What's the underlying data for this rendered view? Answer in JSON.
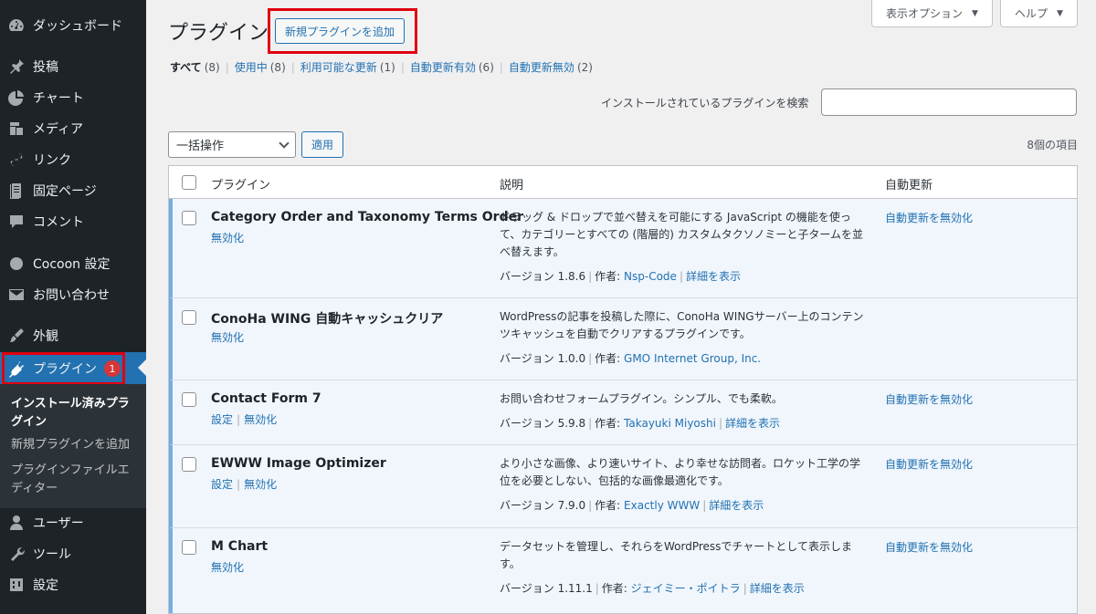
{
  "sidebar": {
    "items": [
      {
        "label": "ダッシュボード",
        "icon": "dashboard-icon"
      },
      {
        "label": "投稿",
        "icon": "pin-icon"
      },
      {
        "label": "チャート",
        "icon": "pie-chart-icon"
      },
      {
        "label": "メディア",
        "icon": "media-icon"
      },
      {
        "label": "リンク",
        "icon": "link-icon"
      },
      {
        "label": "固定ページ",
        "icon": "page-icon"
      },
      {
        "label": "コメント",
        "icon": "comment-icon"
      },
      {
        "label": "Cocoon 設定",
        "icon": "circle-icon"
      },
      {
        "label": "お問い合わせ",
        "icon": "mail-icon"
      },
      {
        "label": "外観",
        "icon": "brush-icon"
      },
      {
        "label": "プラグイン",
        "icon": "plugin-icon",
        "badge": "1"
      },
      {
        "label": "ユーザー",
        "icon": "user-icon"
      },
      {
        "label": "ツール",
        "icon": "wrench-icon"
      },
      {
        "label": "設定",
        "icon": "settings-icon"
      }
    ],
    "submenu": [
      {
        "label": "インストール済みプラグイン"
      },
      {
        "label": "新規プラグインを追加"
      },
      {
        "label": "プラグインファイルエディター"
      }
    ]
  },
  "header": {
    "title": "プラグイン",
    "add_new": "新規プラグインを追加",
    "screen_options": "表示オプション",
    "help": "ヘルプ"
  },
  "filters": [
    {
      "label": "すべて",
      "count": "(8)"
    },
    {
      "label": "使用中",
      "count": "(8)"
    },
    {
      "label": "利用可能な更新",
      "count": "(1)"
    },
    {
      "label": "自動更新有効",
      "count": "(6)"
    },
    {
      "label": "自動更新無効",
      "count": "(2)"
    }
  ],
  "search": {
    "label": "インストールされているプラグインを検索",
    "value": ""
  },
  "bulk": {
    "selected": "一括操作",
    "apply": "適用",
    "count": "8個の項目"
  },
  "table": {
    "columns": {
      "plugin": "プラグイン",
      "description": "説明",
      "auto_update": "自動更新"
    },
    "rows": [
      {
        "name": "Category Order and Taxonomy Terms Order",
        "actions": [
          "無効化"
        ],
        "desc": "ドラッグ & ドロップで並べ替えを可能にする JavaScript の機能を使って、カテゴリーとすべての (階層的) カスタムタクソノミーと子タームを並べ替えます。",
        "version": "バージョン 1.8.6",
        "author_label": "作者:",
        "author": "Nsp-Code",
        "details": "詳細を表示",
        "auto_update": "自動更新を無効化"
      },
      {
        "name": "ConoHa WING 自動キャッシュクリア",
        "actions": [
          "無効化"
        ],
        "desc": "WordPressの記事を投稿した際に、ConoHa WINGサーバー上のコンテンツキャッシュを自動でクリアするプラグインです。",
        "version": "バージョン 1.0.0",
        "author_label": "作者:",
        "author": "GMO Internet Group, Inc.",
        "details": "",
        "auto_update": ""
      },
      {
        "name": "Contact Form 7",
        "actions": [
          "設定",
          "無効化"
        ],
        "desc": "お問い合わせフォームプラグイン。シンプル、でも柔軟。",
        "version": "バージョン 5.9.8",
        "author_label": "作者:",
        "author": "Takayuki Miyoshi",
        "details": "詳細を表示",
        "auto_update": "自動更新を無効化"
      },
      {
        "name": "EWWW Image Optimizer",
        "actions": [
          "設定",
          "無効化"
        ],
        "desc": "より小さな画像、より速いサイト、より幸せな訪問者。ロケット工学の学位を必要としない、包括的な画像最適化です。",
        "version": "バージョン 7.9.0",
        "author_label": "作者:",
        "author": "Exactly WWW",
        "details": "詳細を表示",
        "auto_update": "自動更新を無効化"
      },
      {
        "name": "M Chart",
        "actions": [
          "無効化"
        ],
        "desc": "データセットを管理し、それらをWordPressでチャートとして表示します。",
        "version": "バージョン 1.11.1",
        "author_label": "作者:",
        "author": "ジェイミー・ポイトラ",
        "details": "詳細を表示",
        "auto_update": "自動更新を無効化"
      }
    ]
  },
  "colors": {
    "accent": "#2271b1",
    "sidebar": "#1d2327",
    "highlight": "#e0000f",
    "badge": "#d63638"
  }
}
